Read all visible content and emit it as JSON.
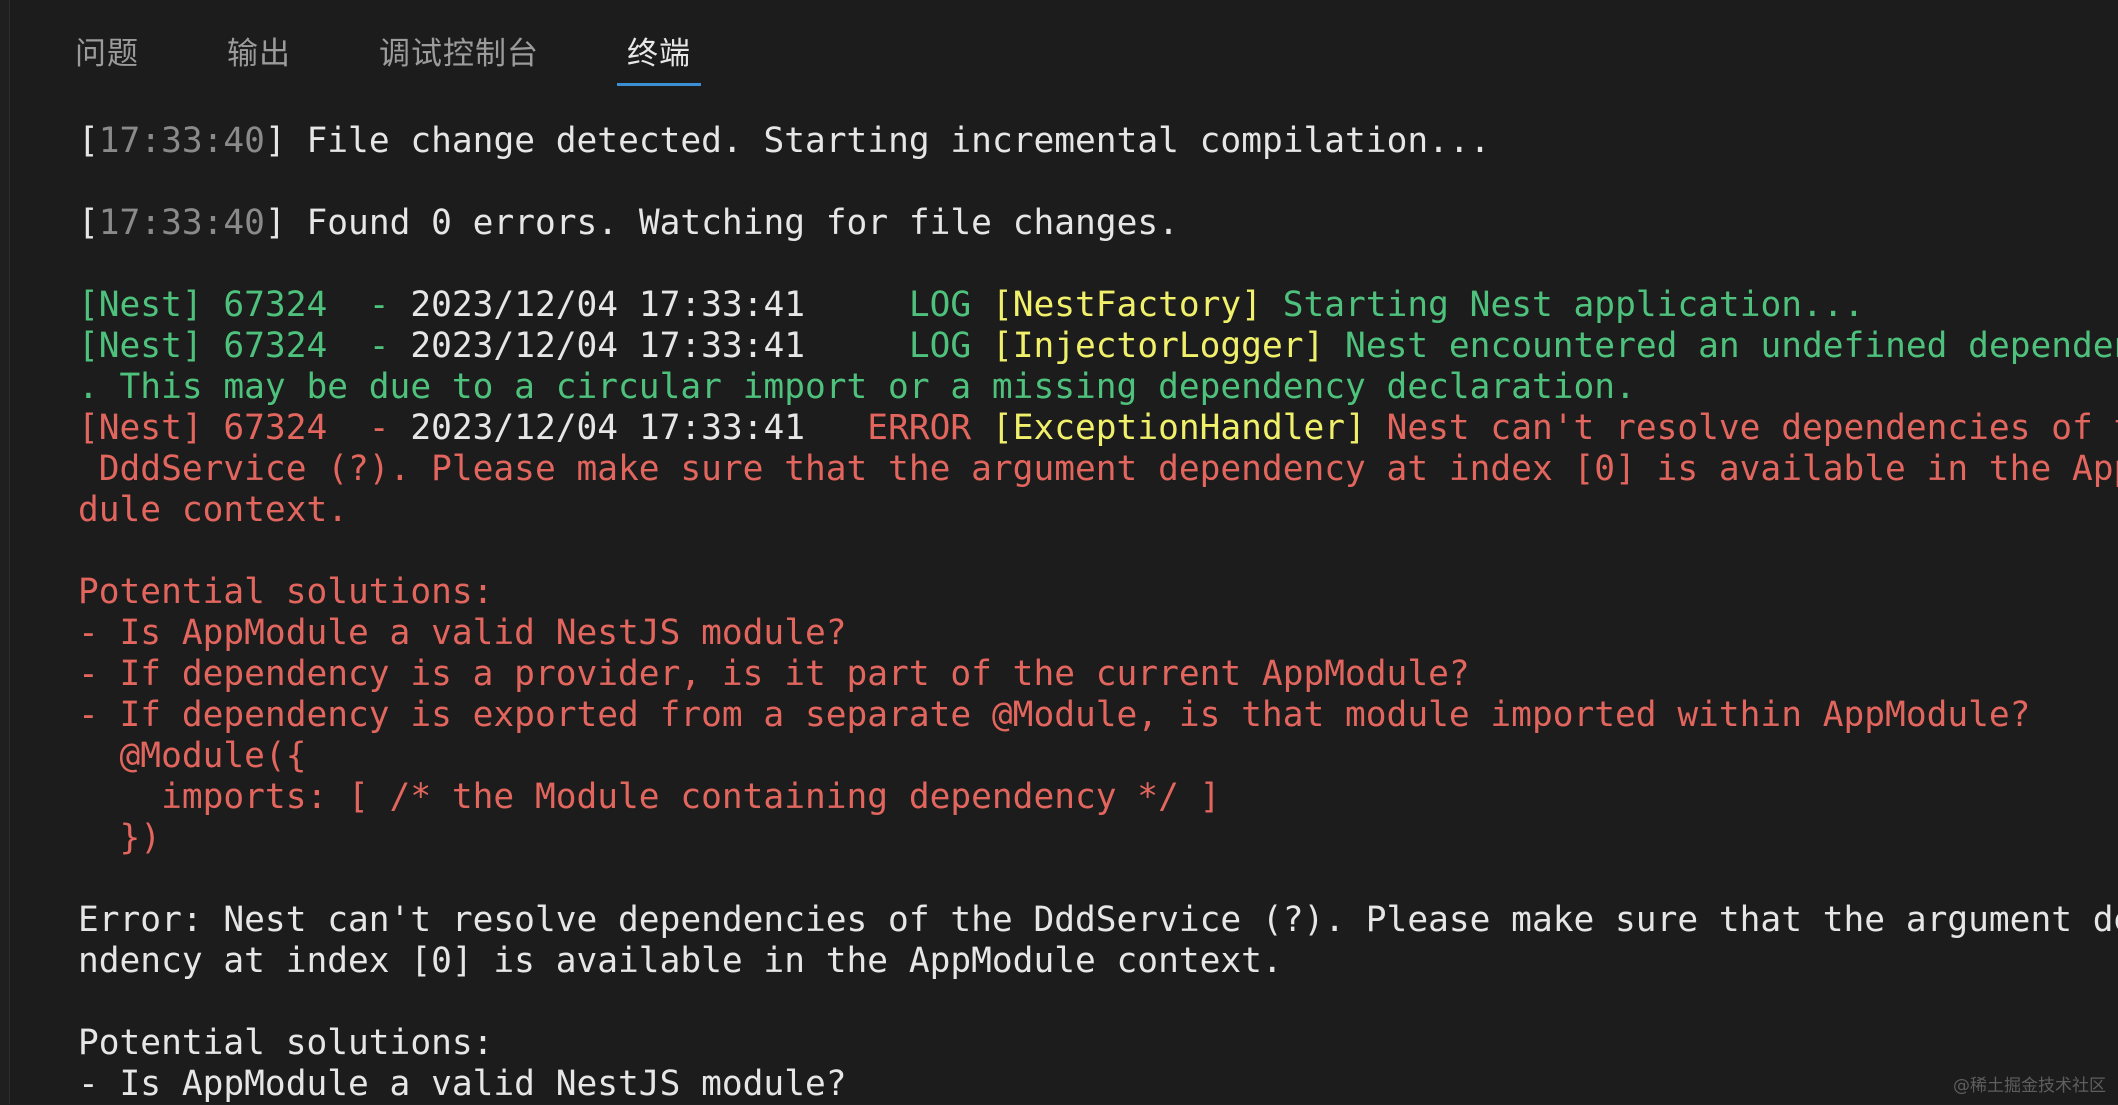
{
  "tabs": [
    {
      "label": "问题"
    },
    {
      "label": "输出"
    },
    {
      "label": "调试控制台"
    },
    {
      "label": "终端"
    }
  ],
  "active_tab": "终端",
  "terminal": {
    "l1_ts": "17:33:40",
    "l1_text": " File change detected. Starting incremental compilation...",
    "l2_ts": "17:33:40",
    "l2_text": " Found 0 errors. Watching for file changes.",
    "n1_prefix": "[Nest] 67324  - ",
    "n1_date": "2023/12/04 17:33:41",
    "n1_level": "     LOG ",
    "n1_ctx": "[NestFactory]",
    "n1_msg": " Starting Nest application...",
    "n2_prefix": "[Nest] 67324  - ",
    "n2_date": "2023/12/04 17:33:41",
    "n2_level": "     LOG ",
    "n2_ctx": "[InjectorLogger]",
    "n2_msg": " Nest encountered an undefined dependency",
    "n2_cont": ". This may be due to a circular import or a missing dependency declaration.",
    "n3_prefix": "[Nest] 67324  - ",
    "n3_date": "2023/12/04 17:33:41",
    "n3_level": "   ERROR ",
    "n3_ctx": "[ExceptionHandler]",
    "n3_msg": " Nest can't resolve dependencies of the",
    "n3_cont1": " DddService (?). Please make sure that the argument dependency at index [0] is available in the AppMo",
    "n3_cont2": "dule context.",
    "ps_title": "Potential solutions:",
    "ps_1": "- Is AppModule a valid NestJS module?",
    "ps_2": "- If dependency is a provider, is it part of the current AppModule?",
    "ps_3": "- If dependency is exported from a separate @Module, is that module imported within AppModule?",
    "ps_4": "  @Module({",
    "ps_5": "    imports: [ /* the Module containing dependency */ ]",
    "ps_6": "  })",
    "err_1": "Error: Nest can't resolve dependencies of the DddService (?). Please make sure that the argument depe",
    "err_2": "ndency at index [0] is available in the AppModule context.",
    "ps2_title": "Potential solutions:",
    "ps2_1": "- Is AppModule a valid NestJS module?"
  },
  "watermark": "@稀土掘金技术社区",
  "colors": {
    "background": "#1c1c1c",
    "tab_active_underline": "#3b8fd4",
    "log_green": "#4ec27c",
    "context_yellow": "#f1f06a",
    "error_red": "#e2665e",
    "timestamp_gray": "#8a8a8a"
  }
}
